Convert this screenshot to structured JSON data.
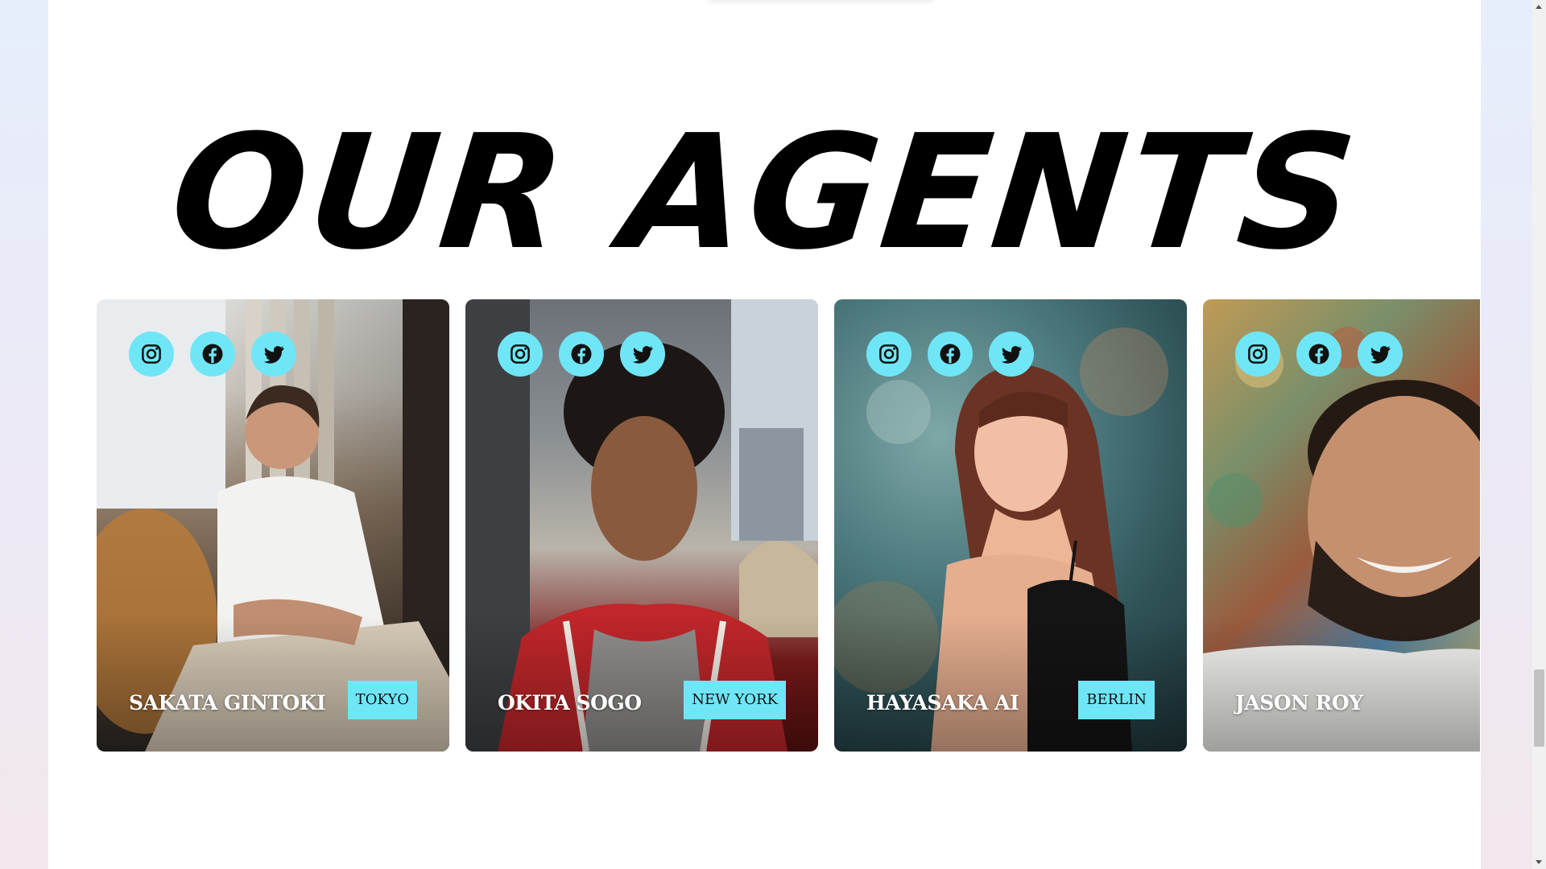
{
  "section": {
    "title": "OUR AGENTS"
  },
  "agents": [
    {
      "name": "SAKATA GINTOKI",
      "city": "TOKYO"
    },
    {
      "name": "OKITA SOGO",
      "city": "NEW YORK"
    },
    {
      "name": "HAYASAKA AI",
      "city": "BERLIN"
    },
    {
      "name": "JASON ROY",
      "city": ""
    }
  ],
  "socials": [
    "instagram-icon",
    "facebook-icon",
    "twitter-icon"
  ],
  "colors": {
    "accent": "#6fe6f6",
    "title": "#000000",
    "page_bg": "#ffffff"
  }
}
